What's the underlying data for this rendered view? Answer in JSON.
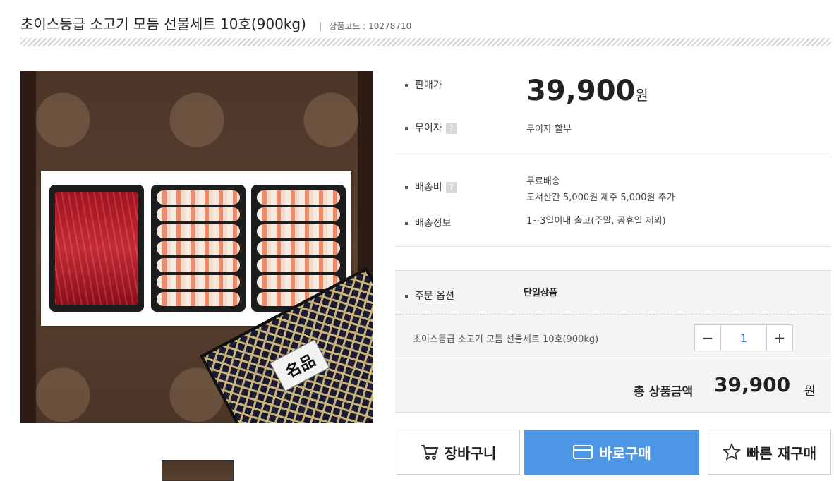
{
  "header": {
    "title": "초이스등급 소고기 모듬 선물세트 10호(900kg)",
    "code_label": "상품코드 : 10278710"
  },
  "image": {
    "box_label": "名品"
  },
  "info": {
    "price_label": "판매가",
    "price_value": "39,900",
    "price_unit": "원",
    "interest_label": "무이자",
    "interest_value": "무이자 할부",
    "help_glyph": "?",
    "shipping_fee_label": "배송비",
    "shipping_fee_line1": "무료배송",
    "shipping_fee_line2": "도서산간 5,000원 제주 5,000원 추가",
    "shipping_info_label": "배송정보",
    "shipping_info_value": "1~3일이내 출고(주말, 공휴일 제외)"
  },
  "options": {
    "label": "주문 옵션",
    "value": "단일상품",
    "item_name": "초이스등급 소고기 모듬 선물세트 10호(900kg)",
    "minus": "−",
    "quantity": "1",
    "plus": "+",
    "total_label": "총 상품금액",
    "total_value": "39,900",
    "total_unit": "원"
  },
  "buttons": {
    "cart": "장바구니",
    "buy_now": "바로구매",
    "quick_reorder": "빠른 재구매"
  },
  "colors": {
    "buy_button": "#4d96e6",
    "quantity_text": "#2d6fd3"
  }
}
